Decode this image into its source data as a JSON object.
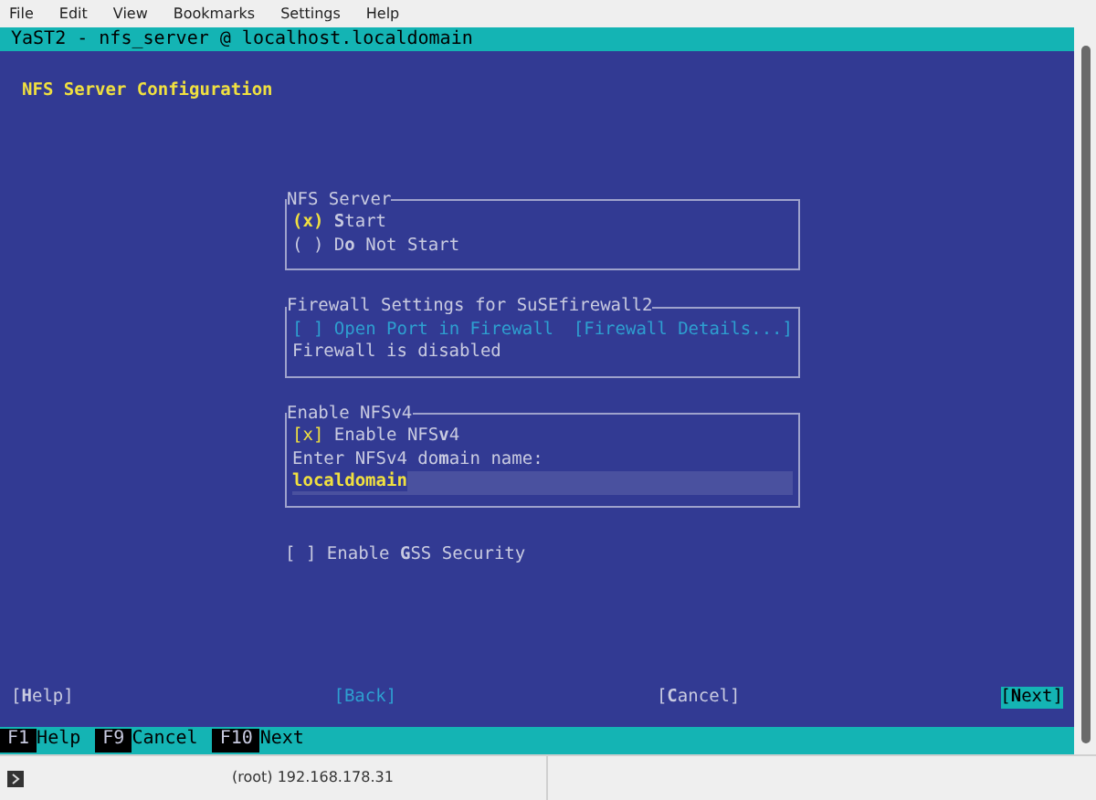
{
  "menu_bar": [
    {
      "label": "File"
    },
    {
      "label": "Edit"
    },
    {
      "label": "View"
    },
    {
      "label": "Bookmarks"
    },
    {
      "label": "Settings"
    },
    {
      "label": "Help"
    }
  ],
  "terminal_title": "YaST2 - nfs_server @ localhost.localdomain",
  "dialog_title": "NFS Server Configuration",
  "nfs_server": {
    "legend": "NFS Server",
    "options": [
      {
        "indicator": "(x)",
        "label": "**S**tart",
        "selected": true
      },
      {
        "indicator": "( )",
        "label": "D**o** Not Start",
        "selected": false
      }
    ]
  },
  "firewall": {
    "legend": "Firewall Settings for SuSEfirewall2",
    "checkbox": {
      "indicator": "[ ]",
      "label": "Open Port in Firewall",
      "checked": false,
      "disabled": true
    },
    "details_button": {
      "label": "[Firewall Details...]",
      "disabled": true
    },
    "status": "Firewall is disabled"
  },
  "nfsv4": {
    "legend": "Enable NFSv4",
    "checkbox": {
      "indicator": "[x]",
      "label": "Enable NFS**v**4",
      "checked": true,
      "disabled": false
    },
    "field_label": "Enter NFSv4 do**m**ain name:",
    "field_value": "localdomain"
  },
  "gss": {
    "indicator": "[ ]",
    "label": "Enable **G**SS Security",
    "checked": false,
    "disabled": false
  },
  "buttons": [
    {
      "label": "[**H**elp]",
      "disabled": false,
      "focused": false
    },
    {
      "label": "[Back]",
      "disabled": true,
      "focused": false
    },
    {
      "label": "[**C**ancel]",
      "disabled": false,
      "focused": false
    },
    {
      "label": "[**N**ext]",
      "disabled": false,
      "focused": true
    }
  ],
  "function_keys": [
    {
      "key": "F1",
      "label": "Help"
    },
    {
      "key": "F9",
      "label": "Cancel"
    },
    {
      "key": "F10",
      "label": "Next"
    }
  ],
  "status_bar": "(root) 192.168.178.31"
}
